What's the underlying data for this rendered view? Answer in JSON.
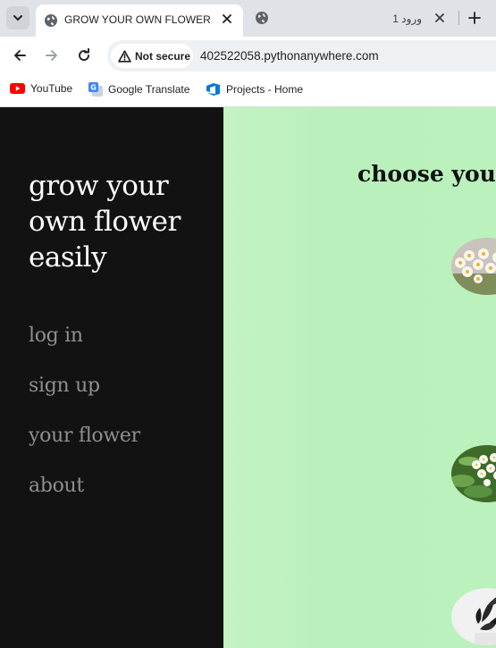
{
  "browser": {
    "active_tab": {
      "title": "GROW YOUR OWN FLOWER"
    },
    "inactive_tab": {
      "title": "ورود 1"
    },
    "security_chip": "Not secure",
    "url": "402522058.pythonanywhere.com",
    "bookmarks": [
      {
        "label": "YouTube",
        "icon": "youtube-icon"
      },
      {
        "label": "Google Translate",
        "icon": "google-translate-icon"
      },
      {
        "label": "Projects - Home",
        "icon": "azure-devops-icon"
      }
    ]
  },
  "sidebar": {
    "title": "grow your own flower easily",
    "nav": [
      "log in",
      "sign up",
      "your flower",
      "about"
    ]
  },
  "main": {
    "heading": "choose your",
    "flowers": [
      {
        "icon": "narcissus-flower-image"
      },
      {
        "icon": "white-flower-bush-image"
      },
      {
        "icon": "dark-potted-plant-image"
      }
    ]
  },
  "colors": {
    "sidebar_bg": "#121212",
    "main_bg": "#b9f0bb",
    "nav_link": "#8f8f8f"
  }
}
